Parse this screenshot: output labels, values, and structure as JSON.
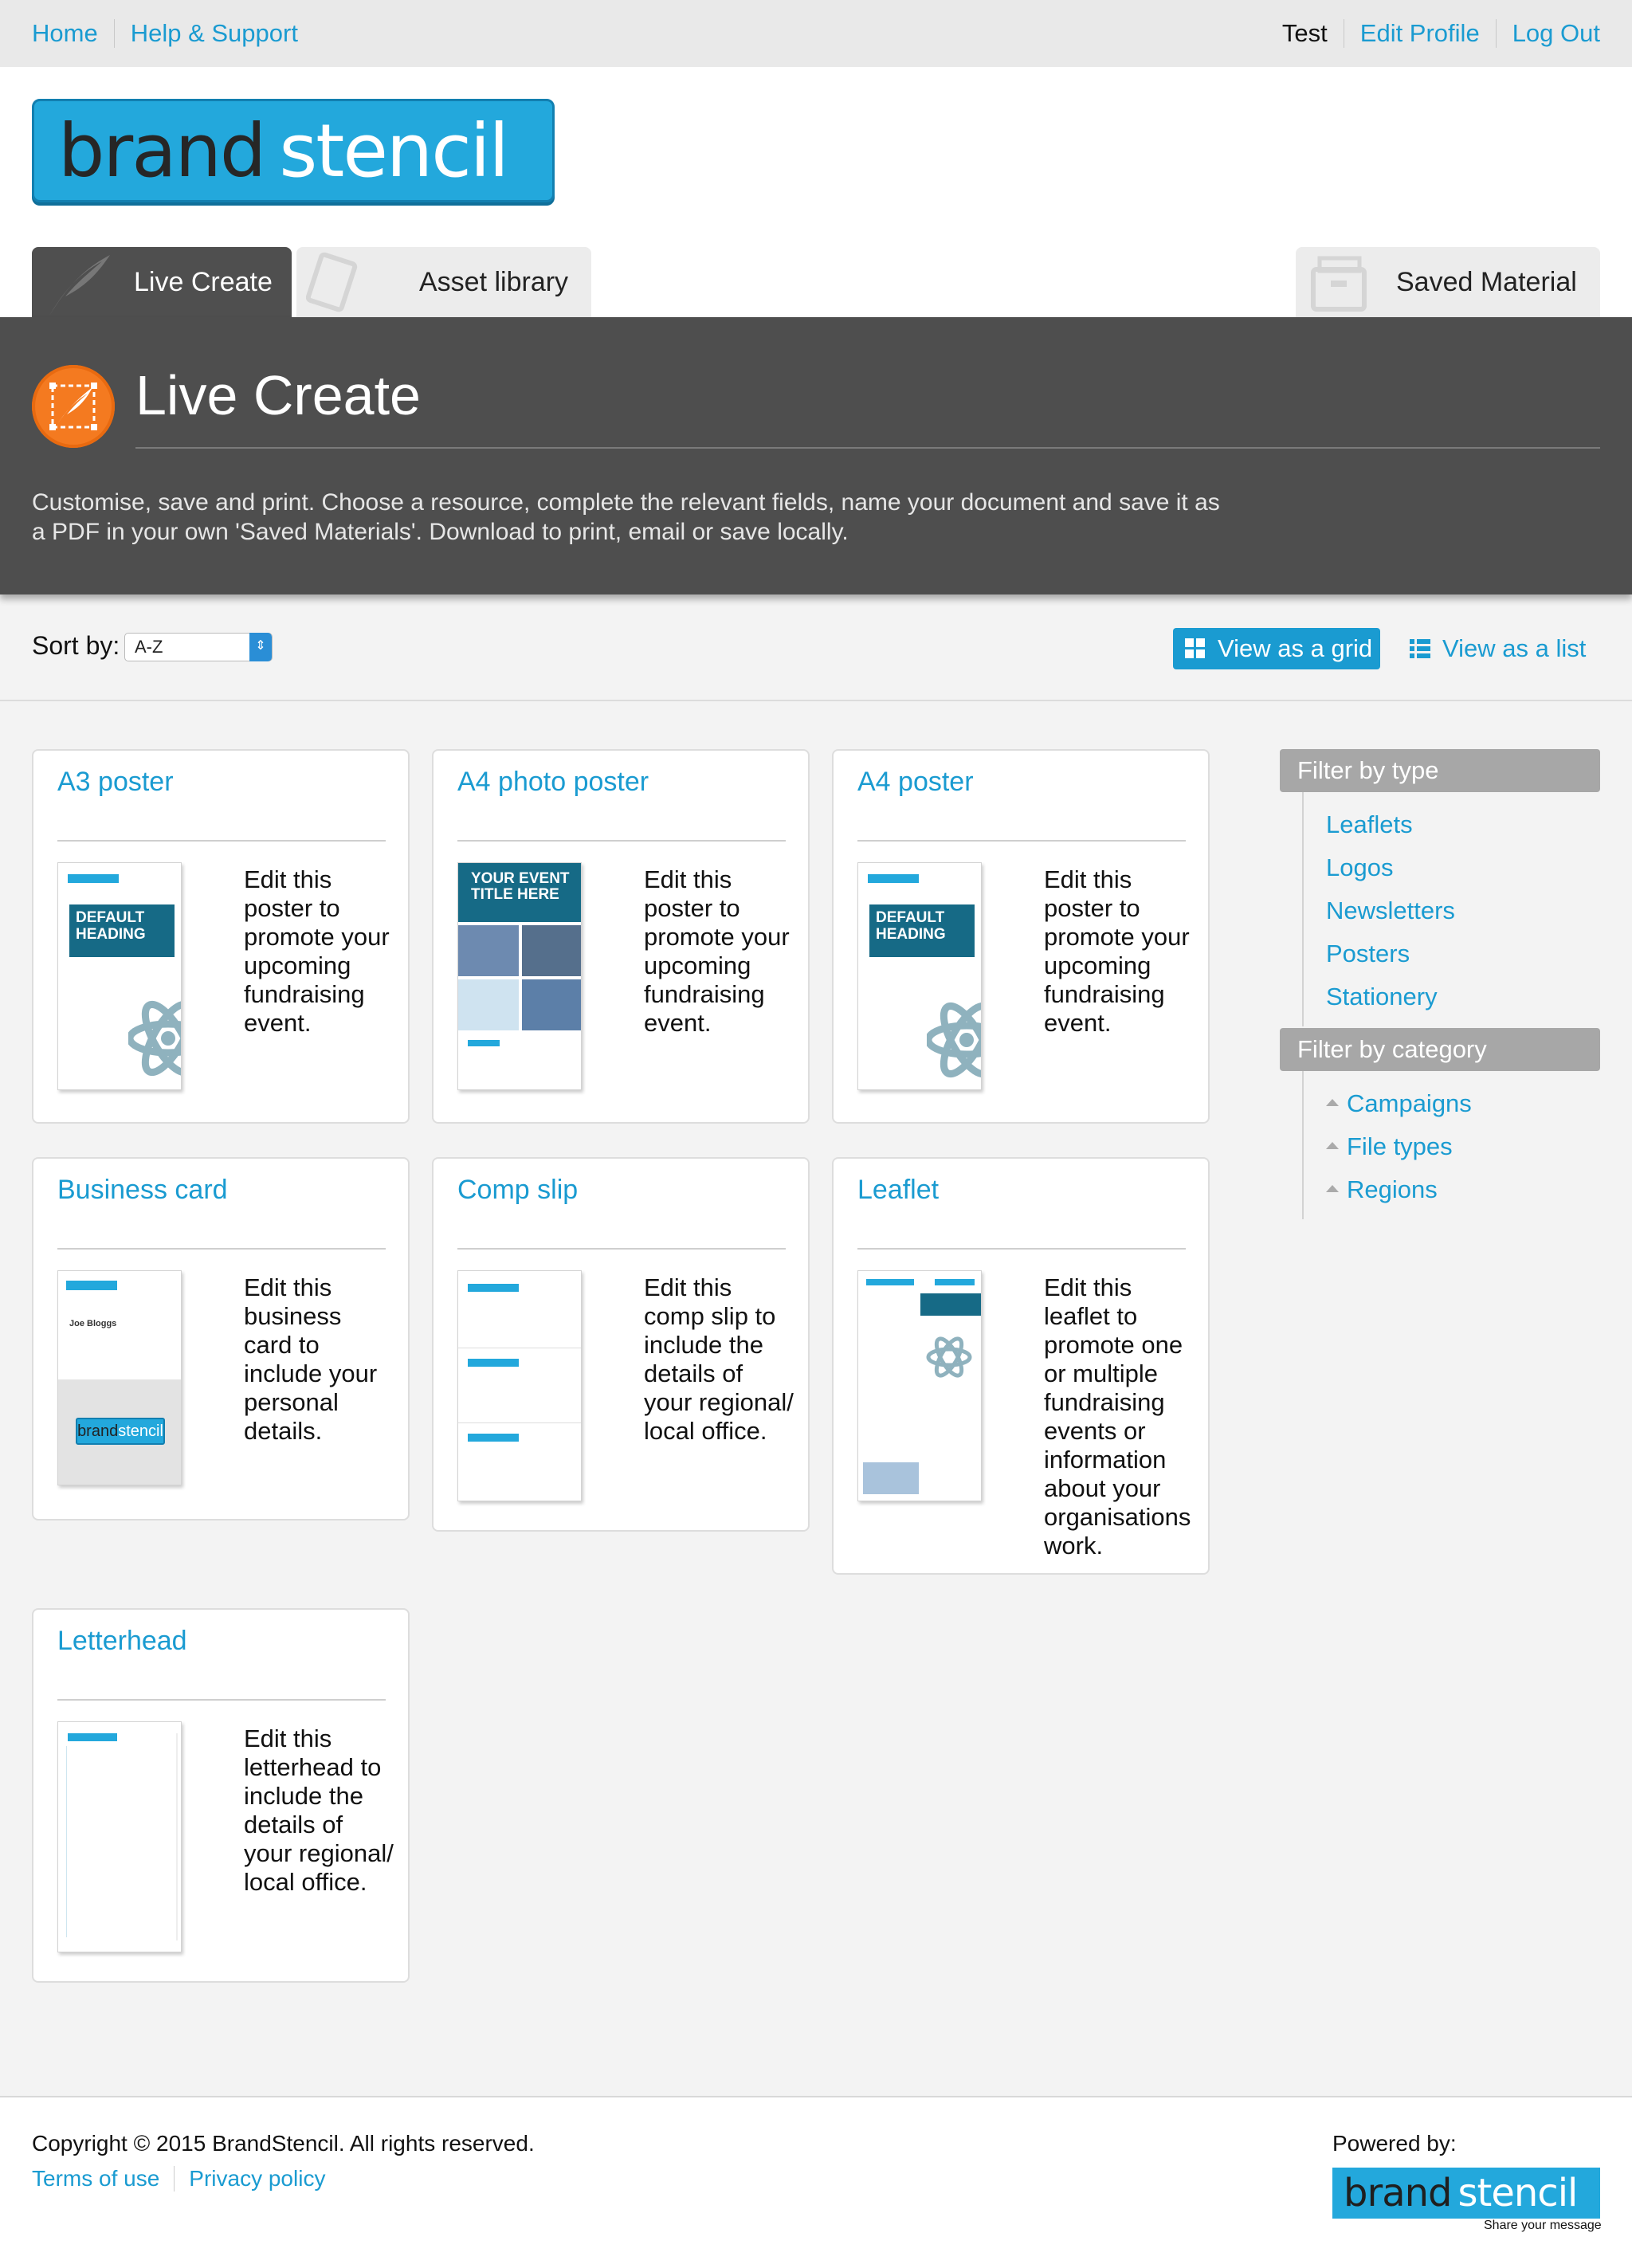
{
  "topnav": {
    "home": "Home",
    "help": "Help & Support",
    "user": "Test",
    "edit_profile": "Edit Profile",
    "logout": "Log Out"
  },
  "brand": {
    "part1": "brand",
    "part2": "stencil",
    "tagline": "Share your message"
  },
  "tabs": {
    "live_create": "Live Create",
    "asset_library": "Asset library",
    "saved_material": "Saved Material"
  },
  "banner": {
    "title": "Live Create",
    "description": "Customise, save and print. Choose a resource, complete the relevant fields, name your document and save it as a PDF in your own 'Saved Materials'. Download to print, email or save locally."
  },
  "sort": {
    "label": "Sort by:",
    "selected": "A-Z"
  },
  "view": {
    "grid": "View as a grid",
    "list": "View as a list"
  },
  "cards": [
    {
      "title": "A3 poster",
      "description": "Edit this poster to promote your upcoming fundraising event.",
      "thumb_heading": "DEFAULT HEADING"
    },
    {
      "title": "A4 photo poster",
      "description": "Edit this poster to promote your upcoming fundraising event.",
      "thumb_heading": "YOUR EVENT TITLE HERE"
    },
    {
      "title": "A4 poster",
      "description": "Edit this poster to promote your upcoming fundraising event.",
      "thumb_heading": "DEFAULT HEADING"
    },
    {
      "title": "Business card",
      "description": "Edit this business card to include your personal details.",
      "thumb_name": "Joe Bloggs"
    },
    {
      "title": "Comp slip",
      "description": "Edit this comp slip to include the details of your regional/ local office."
    },
    {
      "title": "Leaflet",
      "description": "Edit this leaflet to promote one or multiple fundraising events or information about your organisations work."
    },
    {
      "title": "Letterhead",
      "description": "Edit this letterhead to include the details of your regional/ local office."
    }
  ],
  "sidebar": {
    "type_heading": "Filter by type",
    "types": [
      "Leaflets",
      "Logos",
      "Newsletters",
      "Posters",
      "Stationery"
    ],
    "category_heading": "Filter by category",
    "categories": [
      "Campaigns",
      "File types",
      "Regions"
    ]
  },
  "footer": {
    "copyright": "Copyright © 2015 BrandStencil. All rights reserved.",
    "terms": "Terms of use",
    "privacy": "Privacy policy",
    "powered_by": "Powered by:"
  },
  "colors": {
    "accent": "#1a9bd1",
    "banner": "#4e4e4e",
    "orange": "#f47a20",
    "thumb_blue": "#166a86"
  }
}
